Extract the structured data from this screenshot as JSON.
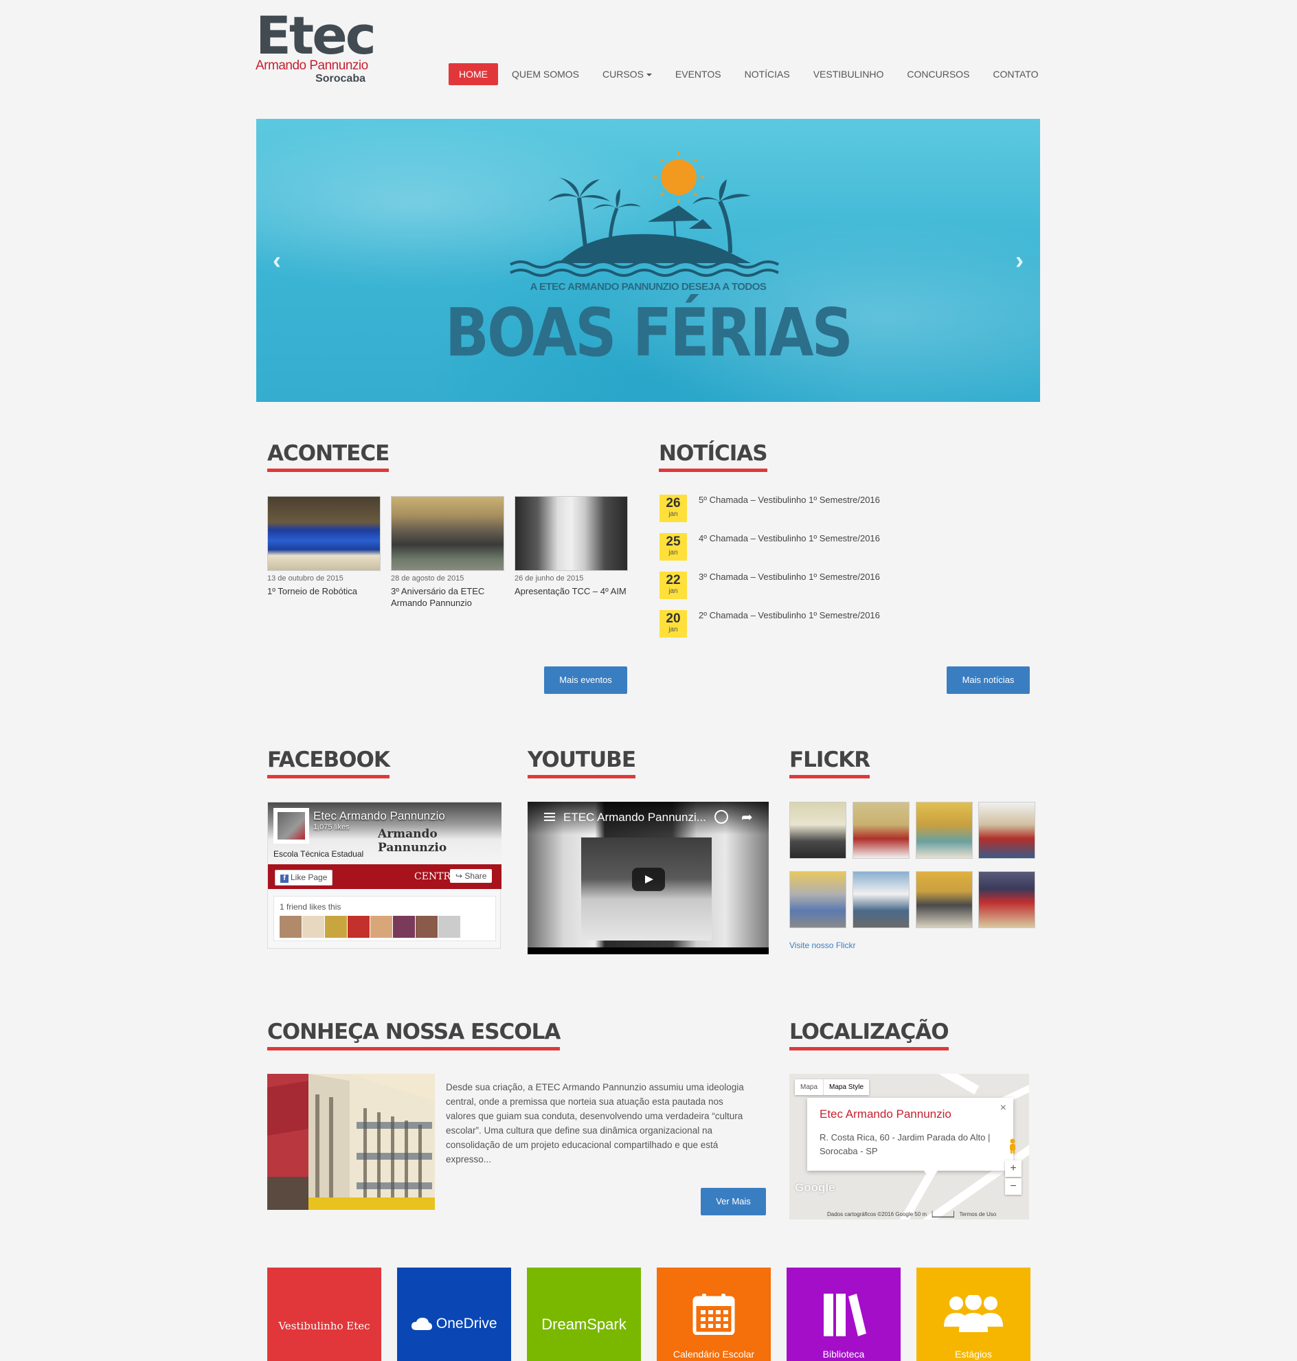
{
  "logo": {
    "main": "Etec",
    "sub": "Armando Pannunzio",
    "city": "Sorocaba"
  },
  "nav": [
    {
      "label": "HOME",
      "active": true
    },
    {
      "label": "QUEM SOMOS"
    },
    {
      "label": "CURSOS",
      "dropdown": true
    },
    {
      "label": "EVENTOS"
    },
    {
      "label": "NOTÍCIAS"
    },
    {
      "label": "VESTIBULINHO"
    },
    {
      "label": "CONCURSOS"
    },
    {
      "label": "CONTATO"
    }
  ],
  "banner": {
    "kicker": "A ETEC ARMANDO PANNUNZIO DESEJA A TODOS",
    "headline": "BOAS FÉRIAS",
    "prev_icon": "chevron-left-icon",
    "next_icon": "chevron-right-icon"
  },
  "acontece": {
    "title": "ACONTECE",
    "events": [
      {
        "date": "13 de outubro de 2015",
        "title": "1º Torneio de Robótica"
      },
      {
        "date": "28 de agosto de 2015",
        "title": "3º Aniversário da ETEC Armando Pannunzio"
      },
      {
        "date": "26 de junho de 2015",
        "title": "Apresentação TCC – 4º AIM"
      }
    ],
    "more_label": "Mais eventos"
  },
  "noticias": {
    "title": "NOTÍCIAS",
    "items": [
      {
        "day": "26",
        "month": "jan",
        "title": "5º Chamada – Vestibulinho 1º Semestre/2016"
      },
      {
        "day": "25",
        "month": "jan",
        "title": "4º Chamada – Vestibulinho 1º Semestre/2016"
      },
      {
        "day": "22",
        "month": "jan",
        "title": "3º Chamada – Vestibulinho 1º Semestre/2016"
      },
      {
        "day": "20",
        "month": "jan",
        "title": "2º Chamada – Vestibulinho 1º Semestre/2016"
      }
    ],
    "more_label": "Mais notícias"
  },
  "facebook": {
    "title": "FACEBOOK",
    "page_name": "Etec Armando Pannunzio",
    "likes": "1,075 likes",
    "cover_text": "Armando Pannunzio",
    "cover_tag": "Escola Técnica Estadual",
    "cover_red_text": "CENTRO P",
    "like_label": "Like Page",
    "share_label": "Share",
    "friends_label": "1 friend likes this"
  },
  "youtube": {
    "title": "YOUTUBE",
    "video_title": "ETEC Armando Pannunzi..."
  },
  "flickr": {
    "title": "FLICKR",
    "link_label": "Visite nosso Flickr"
  },
  "conheca": {
    "title": "CONHEÇA NOSSA ESCOLA",
    "text": "Desde sua criação, a ETEC Armando Pannunzio assumiu uma ideologia central, onde a premissa que norteia sua atuação esta pautada nos valores que guiam sua conduta, desenvolvendo uma verdadeira “cultura escolar”. Uma cultura que define sua dinâmica organizacional na consolidação de um projeto educacional compartilhado e que está expresso...",
    "more_label": "Ver Mais"
  },
  "localizacao": {
    "title": "LOCALIZAÇÃO",
    "tab_map": "Mapa",
    "tab_style": "Mapa Style",
    "place": "Etec Armando Pannunzio",
    "address": "R. Costa Rica, 60 - Jardim Parada do Alto | Sorocaba - SP",
    "google": "Google",
    "footer": "Dados cartográficos ©2016 Google     50 m ▕▁▁▁▁▁▏   Termos de Uso",
    "zoom_in": "+",
    "zoom_out": "−",
    "close": "×"
  },
  "tiles": [
    {
      "label": "Vestibulinho Etec",
      "color": "#e1373b",
      "icon": ""
    },
    {
      "label": "OneDrive",
      "color": "#0a47b5",
      "icon": "cloud-icon"
    },
    {
      "label": "DreamSpark",
      "color": "#7ab800",
      "icon": ""
    },
    {
      "label": "Calendário Escolar",
      "color": "#f56f0a",
      "icon": "calendar-icon"
    },
    {
      "label": "Biblioteca",
      "color": "#a50ec9",
      "icon": "books-icon"
    },
    {
      "label": "Estágios",
      "color": "#f6b600",
      "icon": "users-icon"
    }
  ]
}
